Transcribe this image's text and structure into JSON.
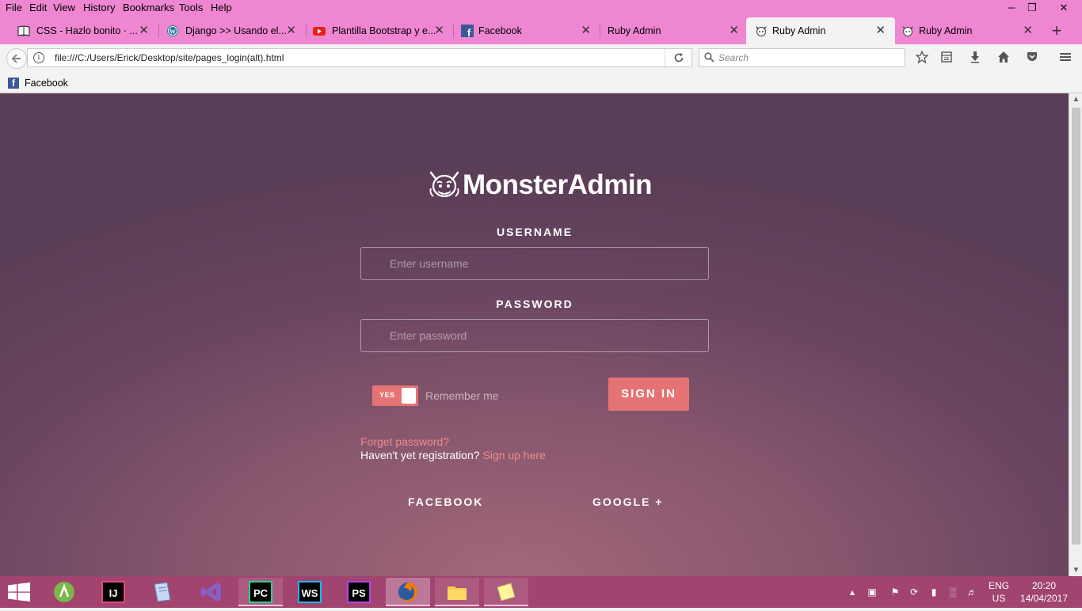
{
  "menubar": {
    "items": [
      "File",
      "Edit",
      "View",
      "History",
      "Bookmarks",
      "Tools",
      "Help"
    ],
    "minimize": "─",
    "restore": "❐",
    "close": "✕"
  },
  "tabs": [
    {
      "title": "CSS - Hazlo bonito · ...",
      "icon": "book-icon"
    },
    {
      "title": "Django >> Usando el...",
      "icon": "wordpress-icon"
    },
    {
      "title": "Plantilla Bootstrap y e...",
      "icon": "youtube-icon"
    },
    {
      "title": "Facebook",
      "icon": "facebook-icon"
    },
    {
      "title": "Ruby Admin",
      "icon": ""
    },
    {
      "title": "Ruby Admin",
      "icon": "monster-icon",
      "active": true
    },
    {
      "title": "Ruby Admin",
      "icon": "monster-icon"
    }
  ],
  "tab_close": "✕",
  "new_tab": "+",
  "nav": {
    "url": "file:///C:/Users/Erick/Desktop/site/pages_login(alt).html",
    "search_placeholder": "Search"
  },
  "bookmarks": [
    {
      "label": "Facebook",
      "icon": "facebook-icon"
    }
  ],
  "login": {
    "brand": "MonsterAdmin",
    "username_label": "USERNAME",
    "username_placeholder": "Enter username",
    "password_label": "PASSWORD",
    "password_placeholder": "Enter password",
    "toggle_text": "YES",
    "remember_me": "Remember me",
    "sign_in": "SIGN IN",
    "forgot": "Forget password?",
    "no_account": "Haven't yet registration?",
    "signup": "Sign up here",
    "facebook": "FACEBOOK",
    "google": "GOOGLE +"
  },
  "colors": {
    "chrome_pink": "#ef86d1",
    "accent": "#e57373",
    "link": "#f08a8a",
    "taskbar": "#a1446f"
  },
  "taskbar": {
    "apps": [
      "Android Studio",
      "IntelliJ IDEA",
      "Notepad",
      "Visual Studio",
      "PyCharm",
      "WebStorm",
      "PhpStorm",
      "Firefox",
      "File Explorer",
      "Sticky Notes"
    ],
    "lang_line1": "ENG",
    "lang_line2": "US",
    "time": "20:20",
    "date": "14/04/2017"
  }
}
